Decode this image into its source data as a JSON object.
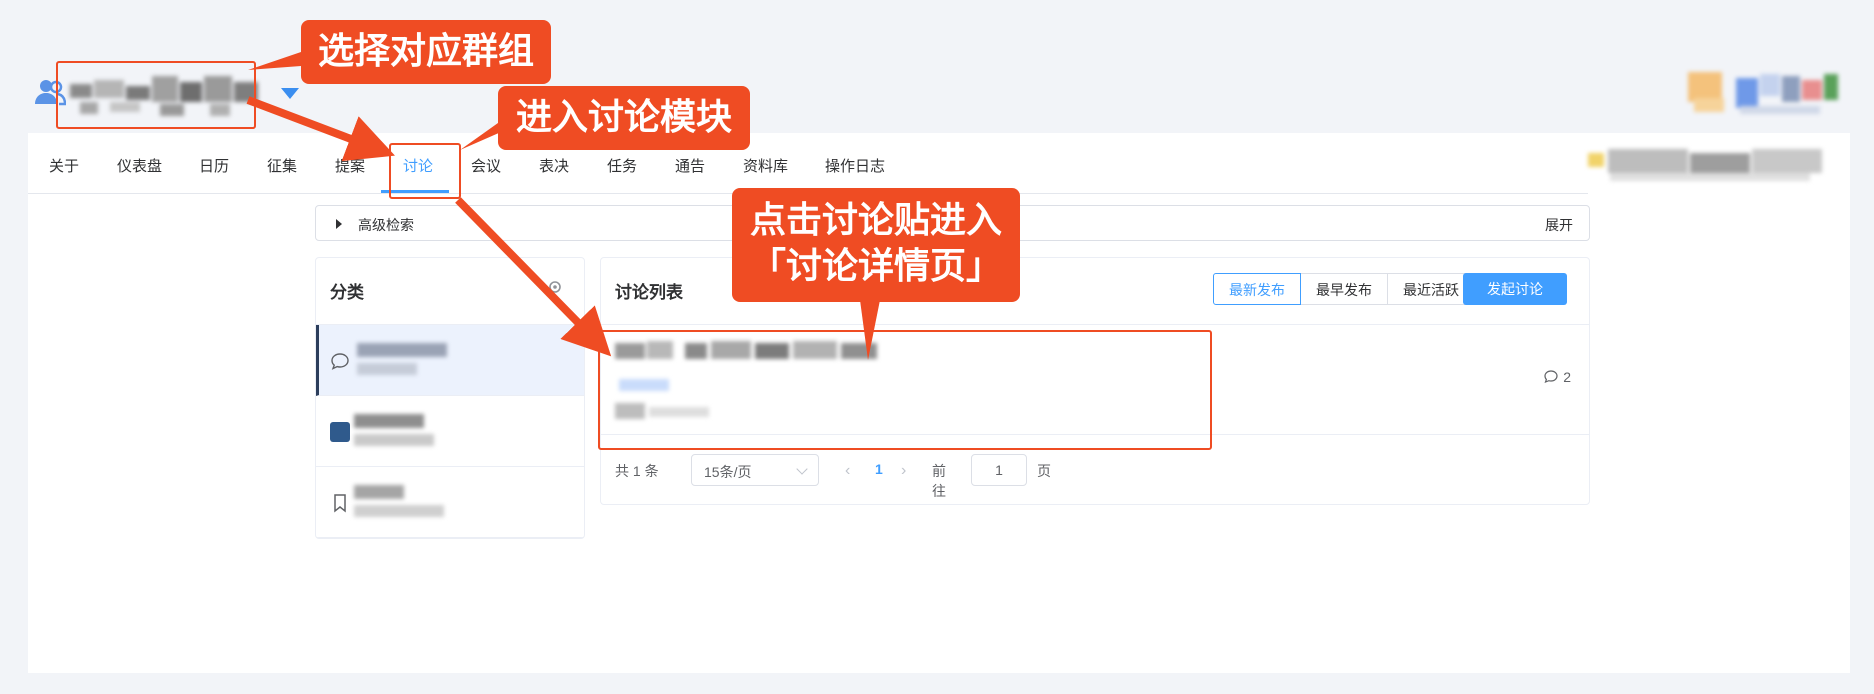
{
  "header": {
    "group_icon": "users-icon",
    "dropdown_icon": "caret-down-icon"
  },
  "tabs": [
    {
      "label": "关于"
    },
    {
      "label": "仪表盘"
    },
    {
      "label": "日历"
    },
    {
      "label": "征集"
    },
    {
      "label": "提案"
    },
    {
      "label": "讨论",
      "active": true
    },
    {
      "label": "会议"
    },
    {
      "label": "表决"
    },
    {
      "label": "任务"
    },
    {
      "label": "通告"
    },
    {
      "label": "资料库"
    },
    {
      "label": "操作日志"
    }
  ],
  "filter": {
    "label": "高级检索",
    "expand_label": "展开"
  },
  "categories": {
    "title": "分类",
    "items": [
      {
        "icon": "chat-bubble-icon",
        "active": true
      },
      {
        "icon": "folder-icon",
        "active": false
      },
      {
        "icon": "bookmark-icon",
        "active": false
      }
    ]
  },
  "discussion_list": {
    "title": "讨论列表",
    "sort_options": [
      "最新发布",
      "最早发布",
      "最近活跃"
    ],
    "sort_selected": "最新发布",
    "new_button": "发起讨论",
    "posts": [
      {
        "comment_count": "2"
      }
    ]
  },
  "pagination": {
    "total_text": "共 1 条",
    "page_size": "15条/页",
    "current_page": "1",
    "goto_label": "前往",
    "goto_value": "1",
    "page_unit": "页"
  },
  "annotations": {
    "step1": "选择对应群组",
    "step2": "进入讨论模块",
    "step3_line1": "点击讨论贴进入",
    "step3_line2": "「讨论详情页」"
  },
  "colors": {
    "accent": "#409eff",
    "annotation": "#ef4c23",
    "background": "#f2f4f8"
  }
}
